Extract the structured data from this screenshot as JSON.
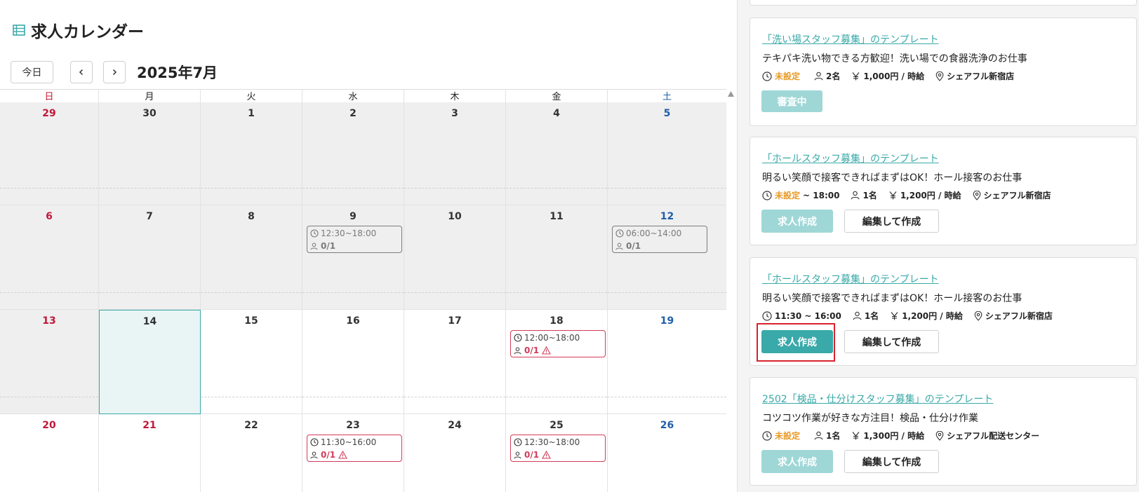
{
  "page": {
    "title": "求人カレンダー"
  },
  "toolbar": {
    "today_label": "今日",
    "month_label": "2025年7月"
  },
  "calendar": {
    "weekdays": [
      "日",
      "月",
      "火",
      "水",
      "木",
      "金",
      "土"
    ],
    "weeks": [
      {
        "days": [
          "29",
          "30",
          "1",
          "2",
          "3",
          "4",
          "5"
        ]
      },
      {
        "days": [
          "6",
          "7",
          "8",
          "9",
          "10",
          "11",
          "12"
        ]
      },
      {
        "days": [
          "13",
          "14",
          "15",
          "16",
          "17",
          "18",
          "19"
        ]
      },
      {
        "days": [
          "20",
          "21",
          "22",
          "23",
          "24",
          "25",
          "26"
        ]
      }
    ],
    "events": [
      {
        "time": "12:30~18:00",
        "count": "0/1"
      },
      {
        "time": "06:00~14:00",
        "count": "0/1"
      },
      {
        "time": "12:00~18:00",
        "count": "0/1"
      },
      {
        "time": "11:30~16:00",
        "count": "0/1"
      },
      {
        "time": "12:30~18:00",
        "count": "0/1"
      }
    ]
  },
  "templates": [
    {
      "title": "「洗い場スタッフ募集」のテンプレート",
      "description": "テキパキ洗い物できる方歓迎！洗い場での食器洗浄のお仕事",
      "time_prefix": "未設定",
      "time_suffix": "",
      "people": "2名",
      "wage": "1,000円 / 時給",
      "location": "シェアフル新宿店",
      "status_label": "審査中"
    },
    {
      "title": "「ホールスタッフ募集」のテンプレート",
      "description": "明るい笑顔で接客できればまずはOK！ホール接客のお仕事",
      "time_prefix": "未設定",
      "time_suffix": "~ 18:00",
      "people": "1名",
      "wage": "1,200円 / 時給",
      "location": "シェアフル新宿店",
      "create_label": "求人作成",
      "edit_label": "編集して作成"
    },
    {
      "title": "「ホールスタッフ募集」のテンプレート",
      "description": "明るい笑顔で接客できればまずはOK！ホール接客のお仕事",
      "time": "11:30 ~ 16:00",
      "people": "1名",
      "wage": "1,200円 / 時給",
      "location": "シェアフル新宿店",
      "create_label": "求人作成",
      "edit_label": "編集して作成"
    },
    {
      "title": "2502「検品・仕分けスタッフ募集」のテンプレート",
      "description": "コツコツ作業が好きな方注目！検品・仕分け作業",
      "time_prefix": "未設定",
      "time_suffix": "",
      "people": "1名",
      "wage": "1,300円 / 時給",
      "location": "シェアフル配送センター",
      "create_label": "求人作成",
      "edit_label": "編集して作成"
    }
  ],
  "colors": {
    "accent": "#3aa9a9",
    "accent_disabled": "#9fd7d7",
    "sunday": "#c0183a",
    "saturday": "#1f5ea8",
    "alert": "#d23b5a",
    "unset": "#e89a26",
    "highlight": "#d9232d"
  }
}
